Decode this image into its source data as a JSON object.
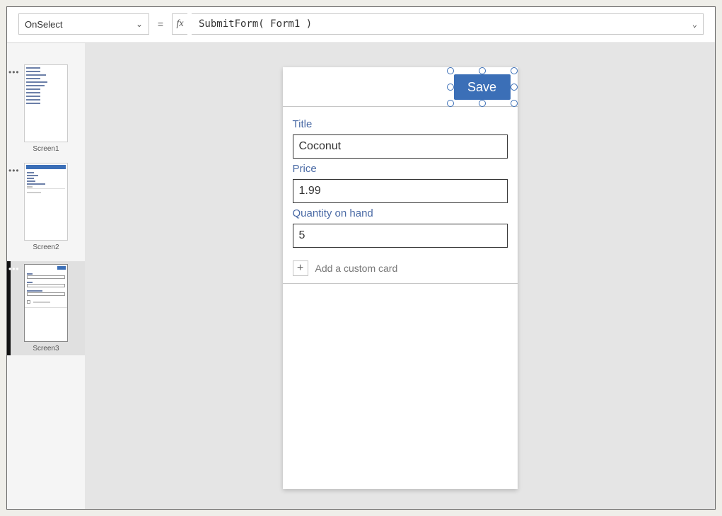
{
  "formula_bar": {
    "property": "OnSelect",
    "equals": "=",
    "fx_label": "fx",
    "expression": "SubmitForm( Form1 )"
  },
  "thumbnails": [
    {
      "label": "Screen1",
      "selected": false
    },
    {
      "label": "Screen2",
      "selected": false
    },
    {
      "label": "Screen3",
      "selected": true
    }
  ],
  "canvas": {
    "save_button_label": "Save",
    "fields": [
      {
        "label": "Title",
        "value": "Coconut"
      },
      {
        "label": "Price",
        "value": "1.99"
      },
      {
        "label": "Quantity on hand",
        "value": "5"
      }
    ],
    "add_card_label": "Add a custom card"
  }
}
